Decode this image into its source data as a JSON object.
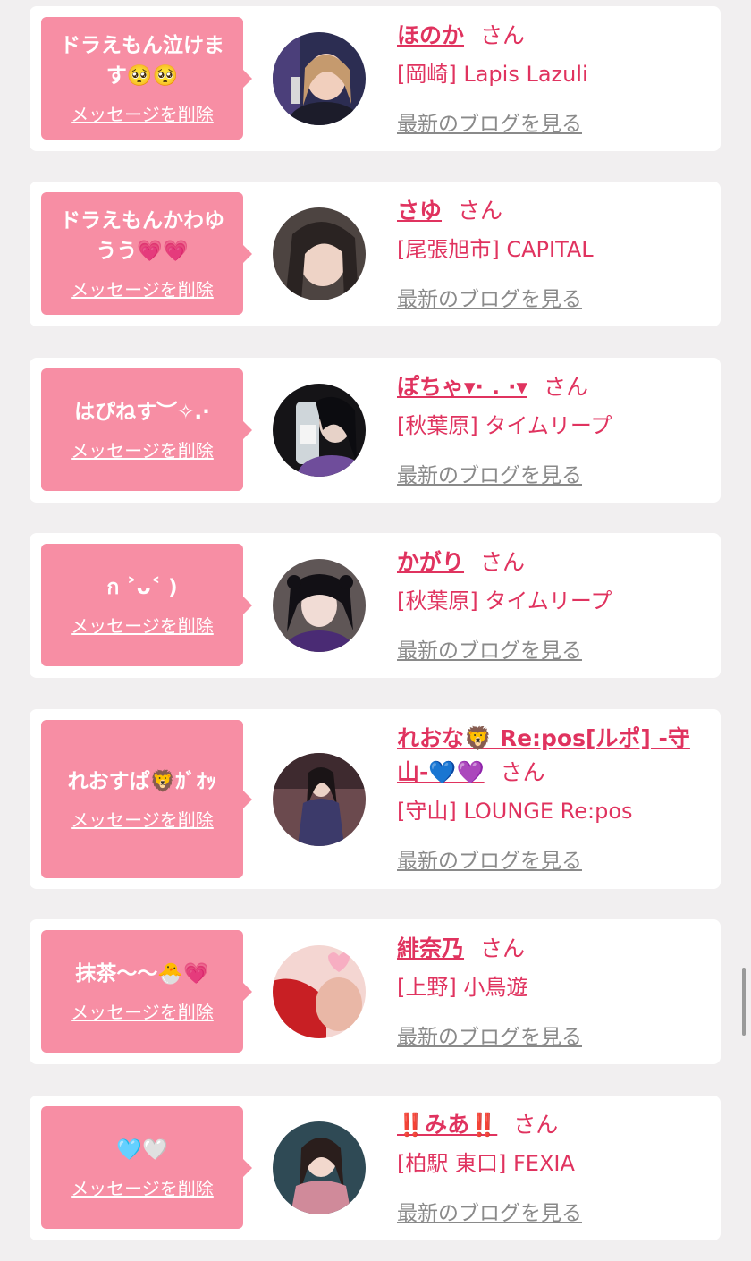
{
  "delete_label": "メッセージを削除",
  "san_label": "さん",
  "blog_label": "最新のブログを見る",
  "entries": [
    {
      "message": "ドラえもん泣けます🥺🥺",
      "name": "ほのか",
      "shop": "[岡崎] Lapis Lazuli"
    },
    {
      "message": "ドラえもんかわゆうう💗💗",
      "name": "さゆ",
      "shop": "[尾張旭市] CAPITAL"
    },
    {
      "message": "はぴねす︶✧.·",
      "name": "ぽちゃ▾· . ·▾",
      "shop": "[秋葉原] タイムリープ"
    },
    {
      "message": "ก ˃ᴗ˂ )",
      "name": "かがり",
      "shop": "[秋葉原] タイムリープ"
    },
    {
      "message": "れおすぱ🦁ｶﾞｵｯ",
      "name": "れおな🦁 Re:pos[ルポ] -守山-💙💜",
      "shop": "[守山] LOUNGE Re:pos"
    },
    {
      "message": "抹茶〜〜🐣💗",
      "name": "緋奈乃",
      "shop": "[上野] 小鳥遊"
    },
    {
      "message": "🩵🤍",
      "name": "‼️みあ‼️",
      "shop": "[柏駅 東口] FEXIA"
    }
  ],
  "colors": {
    "accent": "#e0335f",
    "bubble": "#f78ea4",
    "background": "#f1eff0"
  }
}
